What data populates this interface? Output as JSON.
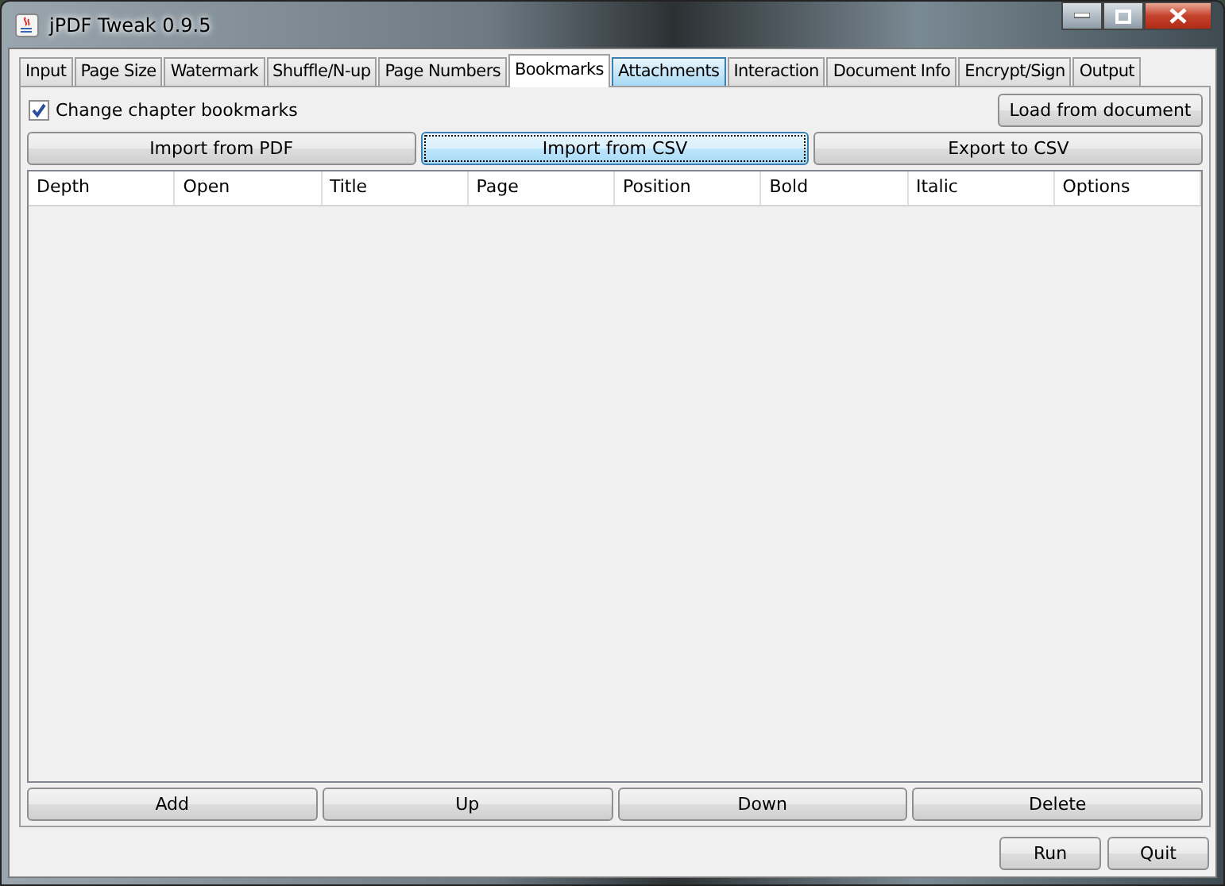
{
  "window": {
    "title": "jPDF Tweak 0.9.5"
  },
  "tabs": [
    {
      "label": "Input",
      "selected": false,
      "hovered": false
    },
    {
      "label": "Page Size",
      "selected": false,
      "hovered": false
    },
    {
      "label": "Watermark",
      "selected": false,
      "hovered": false
    },
    {
      "label": "Shuffle/N-up",
      "selected": false,
      "hovered": false
    },
    {
      "label": "Page Numbers",
      "selected": false,
      "hovered": false
    },
    {
      "label": "Bookmarks",
      "selected": true,
      "hovered": false
    },
    {
      "label": "Attachments",
      "selected": false,
      "hovered": true
    },
    {
      "label": "Interaction",
      "selected": false,
      "hovered": false
    },
    {
      "label": "Document Info",
      "selected": false,
      "hovered": false
    },
    {
      "label": "Encrypt/Sign",
      "selected": false,
      "hovered": false
    },
    {
      "label": "Output",
      "selected": false,
      "hovered": false
    }
  ],
  "change_bookmarks": {
    "label": "Change chapter bookmarks",
    "checked": true
  },
  "load_button": "Load from document",
  "import_buttons": [
    {
      "label": "Import from PDF",
      "focused": false
    },
    {
      "label": "Import from CSV",
      "focused": true
    },
    {
      "label": "Export to CSV",
      "focused": false
    }
  ],
  "table": {
    "columns": [
      "Depth",
      "Open",
      "Title",
      "Page",
      "Position",
      "Bold",
      "Italic",
      "Options"
    ]
  },
  "row_buttons": [
    "Add",
    "Up",
    "Down",
    "Delete"
  ],
  "footer_buttons": [
    "Run",
    "Quit"
  ]
}
